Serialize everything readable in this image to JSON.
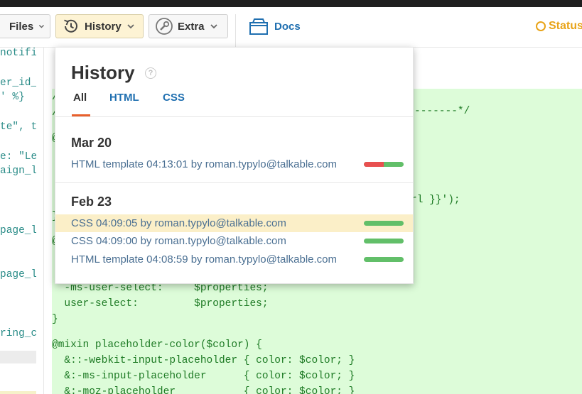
{
  "toolbar": {
    "files_label": "Files",
    "history_label": "History",
    "extra_label": "Extra",
    "docs_label": "Docs",
    "status_label": "Status"
  },
  "left_code": [
    "notifi",
    "",
    "er_id_",
    "' %}",
    "",
    "te\", t",
    "",
    "e: \"Le",
    "aign_l",
    "",
    "",
    "",
    "page_l",
    "",
    "",
    "page_l",
    "",
    "",
    "",
    "ring_c"
  ],
  "code": {
    "l1": "-------*/",
    "l2": "rl }}');",
    "l3": "  -ms-user-select:     $properties;",
    "l4": "  user-select:         $properties;",
    "l5": "}",
    "l6": "@mixin placeholder-color($color) {",
    "l7": "  &::-webkit-input-placeholder { color: $color; }",
    "l8": "  &:-ms-input-placeholder      { color: $color; }",
    "l9": "  &:-moz-placeholder           { color: $color; }"
  },
  "history": {
    "title": "History",
    "help": "?",
    "tabs": [
      "All",
      "HTML",
      "CSS"
    ],
    "groups": [
      {
        "date": "Mar 20",
        "items": [
          {
            "text": "HTML template 04:13:01 by roman.typylo@talkable.com",
            "failed": 0.5
          }
        ]
      },
      {
        "date": "Feb 23",
        "items": [
          {
            "text": "CSS 04:09:05 by roman.typylo@talkable.com",
            "failed": 0
          },
          {
            "text": "CSS 04:09:00 by roman.typylo@talkable.com",
            "failed": 0
          },
          {
            "text": "HTML template 04:08:59 by roman.typylo@talkable.com",
            "failed": 0
          }
        ]
      }
    ]
  },
  "colors": {
    "accent": "#1f6fb0",
    "status": "#e8a317",
    "tab_underline": "#e8602c",
    "bar_ok": "#62bf69",
    "bar_fail": "#e85050"
  }
}
